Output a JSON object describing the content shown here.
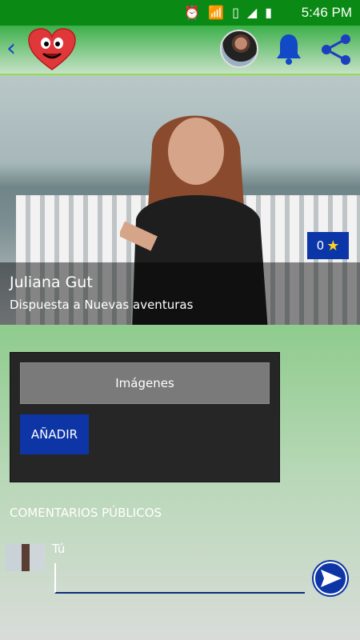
{
  "status_bar": {
    "time": "5:46 PM",
    "icons": [
      "alarm-icon",
      "wifi-icon",
      "sim-icon",
      "signal-icon",
      "battery-icon"
    ]
  },
  "app_bar": {
    "icons": [
      "back-icon",
      "heart-logo",
      "avatar",
      "bell-icon",
      "share-icon"
    ]
  },
  "profile": {
    "name": "Juliana Gut",
    "status": "Dispuesta a Nuevas aventuras",
    "rating": "0"
  },
  "panel": {
    "images_label": "Imágenes",
    "add_label": "AÑADIR"
  },
  "comments": {
    "title": "COMENTARIOS PÚBLICOS",
    "author": "Tú",
    "input_value": ""
  },
  "colors": {
    "accent_blue": "#0d35a6",
    "status_bar": "#0a8a14",
    "star": "#ffd21f"
  }
}
